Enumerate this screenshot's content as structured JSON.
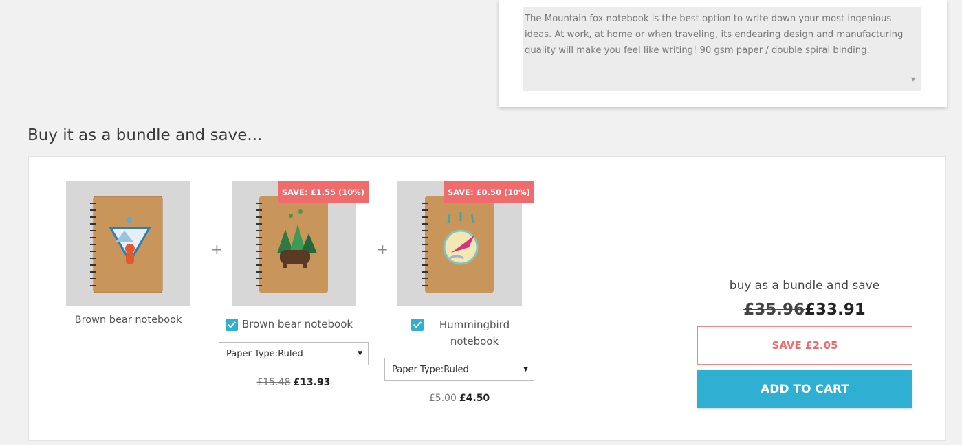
{
  "description": {
    "text": "The Mountain fox notebook is the best option to write down your most ingenious ideas. At work, at home or when traveling, its endearing design and manufacturing quality will make you feel like writing! 90 gsm paper / double spiral binding.",
    "scroll_icon": "caret-down-icon"
  },
  "bundle": {
    "heading": "Buy it as a bundle and save...",
    "plus_symbol": "+",
    "products": [
      {
        "name": "Brown bear notebook",
        "image_icon": "fox-notebook-image"
      },
      {
        "name": "Brown bear notebook",
        "save_badge": "SAVE: £1.55 (10%)",
        "checked": true,
        "select_value": "Paper Type:Ruled",
        "old_price": "£15.48",
        "new_price": "£13.93",
        "image_icon": "bear-notebook-image"
      },
      {
        "name": "Hummingbird notebook",
        "save_badge": "SAVE: £0.50 (10%)",
        "checked": true,
        "select_value": "Paper Type:Ruled",
        "old_price": "£5.00",
        "new_price": "£4.50",
        "image_icon": "hummingbird-notebook-image"
      }
    ],
    "summary": {
      "label": "buy as a bundle and save",
      "old_total": "£35.96",
      "new_total": "£33.91",
      "save_text": "SAVE £2.05",
      "add_to_cart": "ADD TO CART"
    }
  },
  "colors": {
    "accent": "#2fb0d2",
    "save_red": "#ef6a6a",
    "background": "#f1f1f1"
  }
}
